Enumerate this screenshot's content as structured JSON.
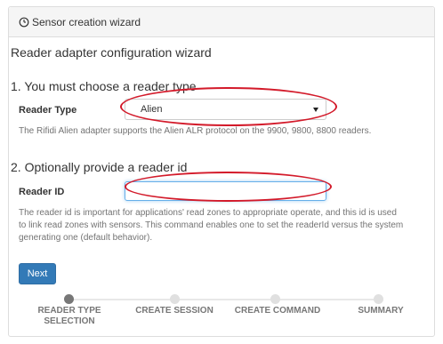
{
  "panel": {
    "title": "Sensor creation wizard",
    "icon": "clock-icon"
  },
  "wizard_title": "Reader adapter configuration wizard",
  "step1": {
    "heading": "1. You must choose a reader type",
    "label": "Reader Type",
    "selected": "Alien",
    "help": "The Rifidi Alien adapter supports the Alien ALR protocol on the 9900, 9800, 8800 readers."
  },
  "step2": {
    "heading": "2. Optionally provide a reader id",
    "label": "Reader ID",
    "value": "",
    "help_line1": "The reader id is important for applications' read zones to appropriate operate, and this id is used",
    "help_line2": "to link read zones with sensors. This command enables one to set the readerId versus the system",
    "help_line3": "generating one (default behavior)."
  },
  "next_button": "Next",
  "progress": {
    "steps": [
      {
        "line1": "READER TYPE",
        "line2": "SELECTION",
        "active": true
      },
      {
        "line1": "CREATE SESSION",
        "line2": "",
        "active": false
      },
      {
        "line1": "CREATE COMMAND",
        "line2": "",
        "active": false
      },
      {
        "line1": "SUMMARY",
        "line2": "",
        "active": false
      }
    ]
  },
  "colors": {
    "primary": "#337ab7",
    "annotation": "#d31a2a",
    "active_dot": "#777777"
  }
}
